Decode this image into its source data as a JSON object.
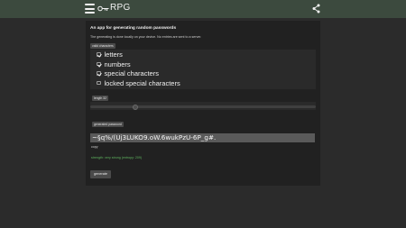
{
  "app": {
    "title": "RPG"
  },
  "topbar": {
    "menu_icon": "hamburger-menu-icon",
    "logo_icon": "key-icon",
    "share_icon": "share-icon"
  },
  "card": {
    "heading": "An app for generating random passwords",
    "subtext": "The generating is done locally on your device. No entries are sent to a server.",
    "valid_characters": {
      "label": "valid characters",
      "options": [
        {
          "label": "letters",
          "checked": true
        },
        {
          "label": "numbers",
          "checked": true
        },
        {
          "label": "special characters",
          "checked": true
        },
        {
          "label": "locked special characters",
          "checked": false
        }
      ]
    },
    "length": {
      "label": "length 32",
      "value": 32,
      "fill_fraction": 0.2
    },
    "generated": {
      "label": "generated password",
      "password": "~§q%/(Uj3LUKO9.oW.6wukPzU-6P_g#.",
      "copy": "copy",
      "strength": "strength: very strong (entropy: 209)"
    },
    "generate_button": "generate"
  },
  "colors": {
    "topbar": "#3c4a3e",
    "background": "#2b2b2b",
    "card": "#212121",
    "strength": "#5fb45f"
  }
}
